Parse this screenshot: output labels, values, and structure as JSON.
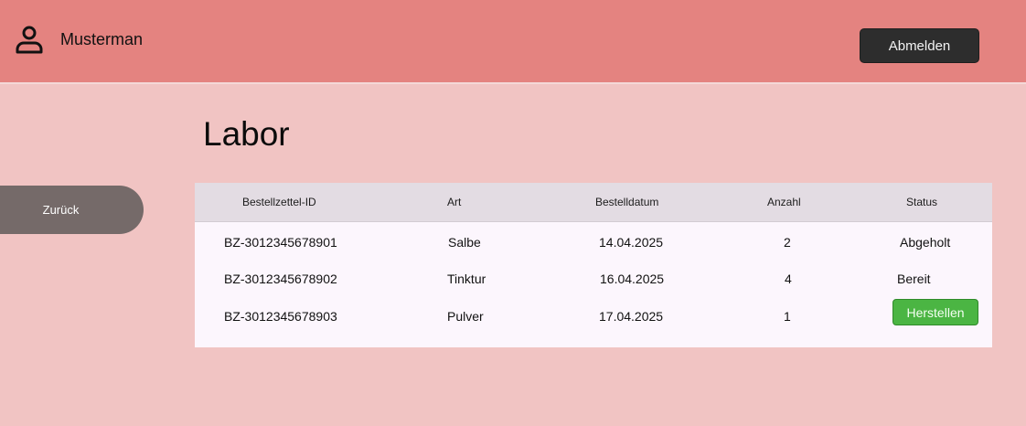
{
  "header": {
    "user_name": "Musterman",
    "logout_label": "Abmelden",
    "user_icon": "user-icon"
  },
  "page": {
    "title": "Labor",
    "back_label": "Zurück"
  },
  "table": {
    "columns": [
      "Bestellzettel-ID",
      "Art",
      "Bestelldatum",
      "Anzahl",
      "Status"
    ],
    "rows": [
      {
        "id": "BZ-3012345678901",
        "art": "Salbe",
        "datum": "14.04.2025",
        "anzahl": "2",
        "status": "Abgeholt"
      },
      {
        "id": "BZ-3012345678902",
        "art": "Tinktur",
        "datum": "16.04.2025",
        "anzahl": "4",
        "status": "Bereit"
      },
      {
        "id": "BZ-3012345678903",
        "art": "Pulver",
        "datum": "17.04.2025",
        "anzahl": "1",
        "status": "Herstellen"
      }
    ]
  },
  "colors": {
    "header_bg": "#e48380",
    "page_bg": "#f1c4c3",
    "logout_bg": "#2d2d2d",
    "back_bg": "#756a69",
    "action_green": "#4bb543"
  }
}
